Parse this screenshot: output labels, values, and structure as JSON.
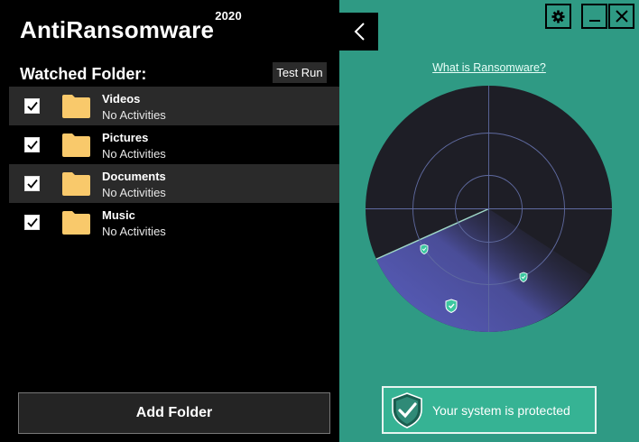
{
  "app": {
    "title": "AntiRansomware",
    "version": "2020"
  },
  "watched": {
    "label": "Watched Folder:",
    "test_run_label": "Test Run",
    "folders": [
      {
        "name": "Videos",
        "status": "No Activities",
        "checked": true
      },
      {
        "name": "Pictures",
        "status": "No Activities",
        "checked": true
      },
      {
        "name": "Documents",
        "status": "No Activities",
        "checked": true
      },
      {
        "name": "Music",
        "status": "No Activities",
        "checked": true
      }
    ],
    "add_folder_label": "Add Folder"
  },
  "right_panel": {
    "what_link": "What is Ransomware?",
    "status_text": "Your system is protected"
  },
  "icons": {
    "back": "chevron-left-icon",
    "settings": "gear-icon",
    "minimize": "minimize-icon",
    "close": "close-icon",
    "folder": "folder-icon",
    "checkbox": "checkmark-icon",
    "shield": "shield-check-icon"
  },
  "colors": {
    "accent": "#2f9a84",
    "status_box": "#36b394",
    "folder": "#f9c96b",
    "radar_bg": "#1e1e26",
    "radar_sweep": "#5a5fc0"
  }
}
